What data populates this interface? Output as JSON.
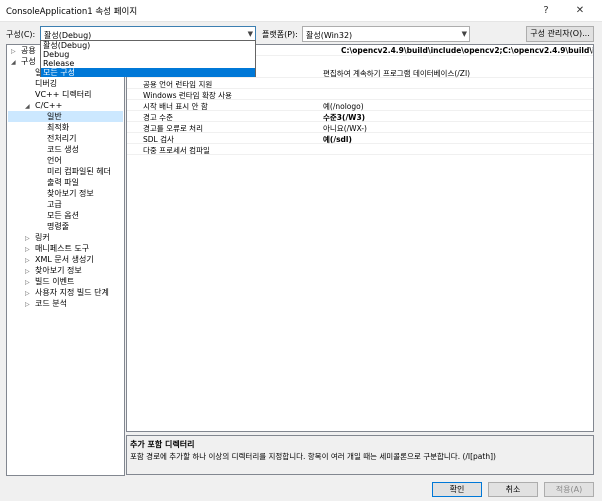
{
  "window": {
    "title": "ConsoleApplication1 속성 페이지",
    "help": "?",
    "close": "✕"
  },
  "toolbar": {
    "config_label": "구성(C):",
    "config_value": "활성(Debug)",
    "platform_label": "플랫폼(P):",
    "platform_value": "활성(Win32)",
    "config_manager": "구성 관리자(O)..."
  },
  "dropdown": {
    "options": [
      "활성(Debug)",
      "Debug",
      "Release",
      "모든 구성"
    ],
    "selected": "모든 구성"
  },
  "tree": {
    "top1": "공용",
    "top2": "구성",
    "general": "일반",
    "debugging": "디버깅",
    "vcpp": "VC++ 디렉터리",
    "cpp": "C/C++",
    "cpp_children": [
      "일반",
      "최적화",
      "전처리기",
      "코드 생성",
      "언어",
      "미리 컴파일된 헤더",
      "출력 파일",
      "찾아보기 정보",
      "고급",
      "모든 옵션",
      "명령줄"
    ],
    "bottom": [
      "링커",
      "매니페스트 도구",
      "XML 문서 생성기",
      "찾아보기 정보",
      "빌드 이벤트",
      "사용자 지정 빌드 단계",
      "코드 분석"
    ]
  },
  "grid": {
    "include_value": "C:\\opencv2.4.9\\build\\include\\opencv2;C:\\opencv2.4.9\\build\\include\\opencv",
    "rows": [
      {
        "k": "",
        "v": "편집하여 계속하기 프로그램 데이터베이스(/ZI)",
        "bold": false
      },
      {
        "k": "공용 언어 런타임 지원",
        "v": "",
        "bold": false
      },
      {
        "k": "Windows 런타임 확장 사용",
        "v": "",
        "bold": false
      },
      {
        "k": "시작 배너 표시 안 함",
        "v": "예(/nologo)",
        "bold": false
      },
      {
        "k": "경고 수준",
        "v": "수준3(/W3)",
        "bold": true
      },
      {
        "k": "경고를 오류로 처리",
        "v": "아니요(/WX-)",
        "bold": false
      },
      {
        "k": "SDL 검사",
        "v": "예(/sdl)",
        "bold": true
      },
      {
        "k": "다중 프로세서 컴파일",
        "v": "",
        "bold": false
      }
    ]
  },
  "description": {
    "heading": "추가 포함 디렉터리",
    "text": "포함 경로에 추가할 하나 이상의 디렉터리를 지정합니다. 항목이 여러 개일 때는 세미콜론으로 구분합니다.     (/I[path])"
  },
  "buttons": {
    "ok": "확인",
    "cancel": "취소",
    "apply": "적용(A)"
  }
}
